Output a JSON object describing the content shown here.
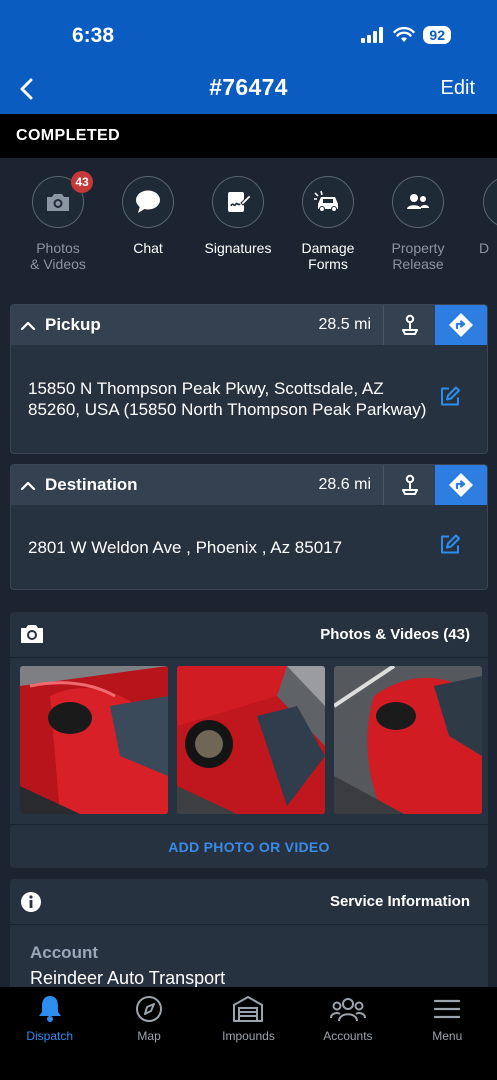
{
  "status": {
    "time": "6:38",
    "battery": "92"
  },
  "nav": {
    "title": "#76474",
    "edit": "Edit"
  },
  "job_status": "COMPLETED",
  "actions": [
    {
      "label": "Photos\n& Videos",
      "badge": "43",
      "icon": "camera-icon",
      "muted": true
    },
    {
      "label": "Chat",
      "icon": "chat-bubble-icon"
    },
    {
      "label": "Signatures",
      "icon": "signature-icon"
    },
    {
      "label": "Damage\nForms",
      "icon": "car-damage-icon"
    },
    {
      "label": "Property\nRelease",
      "icon": "people-icon",
      "muted": true
    },
    {
      "label": "D",
      "icon": "partial-icon",
      "muted": true
    }
  ],
  "pickup": {
    "title": "Pickup",
    "distance": "28.5 mi",
    "address": "15850 N Thompson Peak Pkwy, Scottsdale, AZ 85260, USA (15850 North Thompson Peak Parkway)"
  },
  "destination": {
    "title": "Destination",
    "distance": "28.6 mi",
    "address": "2801 W Weldon Ave , Phoenix , Az 85017"
  },
  "photos": {
    "title": "Photos & Videos (43)",
    "add_label": "ADD PHOTO OR VIDEO"
  },
  "service": {
    "title": "Service Information",
    "account_label": "Account",
    "account_value": "Reindeer Auto Transport"
  },
  "tabs": [
    {
      "label": "Dispatch",
      "icon": "bell-icon",
      "active": true
    },
    {
      "label": "Map",
      "icon": "map-compass-icon"
    },
    {
      "label": "Impounds",
      "icon": "garage-icon"
    },
    {
      "label": "Accounts",
      "icon": "group-icon"
    },
    {
      "label": "Menu",
      "icon": "hamburger-icon"
    }
  ],
  "colors": {
    "header": "#0b5cc0",
    "accent": "#2d7ee0",
    "badge": "#c6383a",
    "background": "#1b2430"
  }
}
